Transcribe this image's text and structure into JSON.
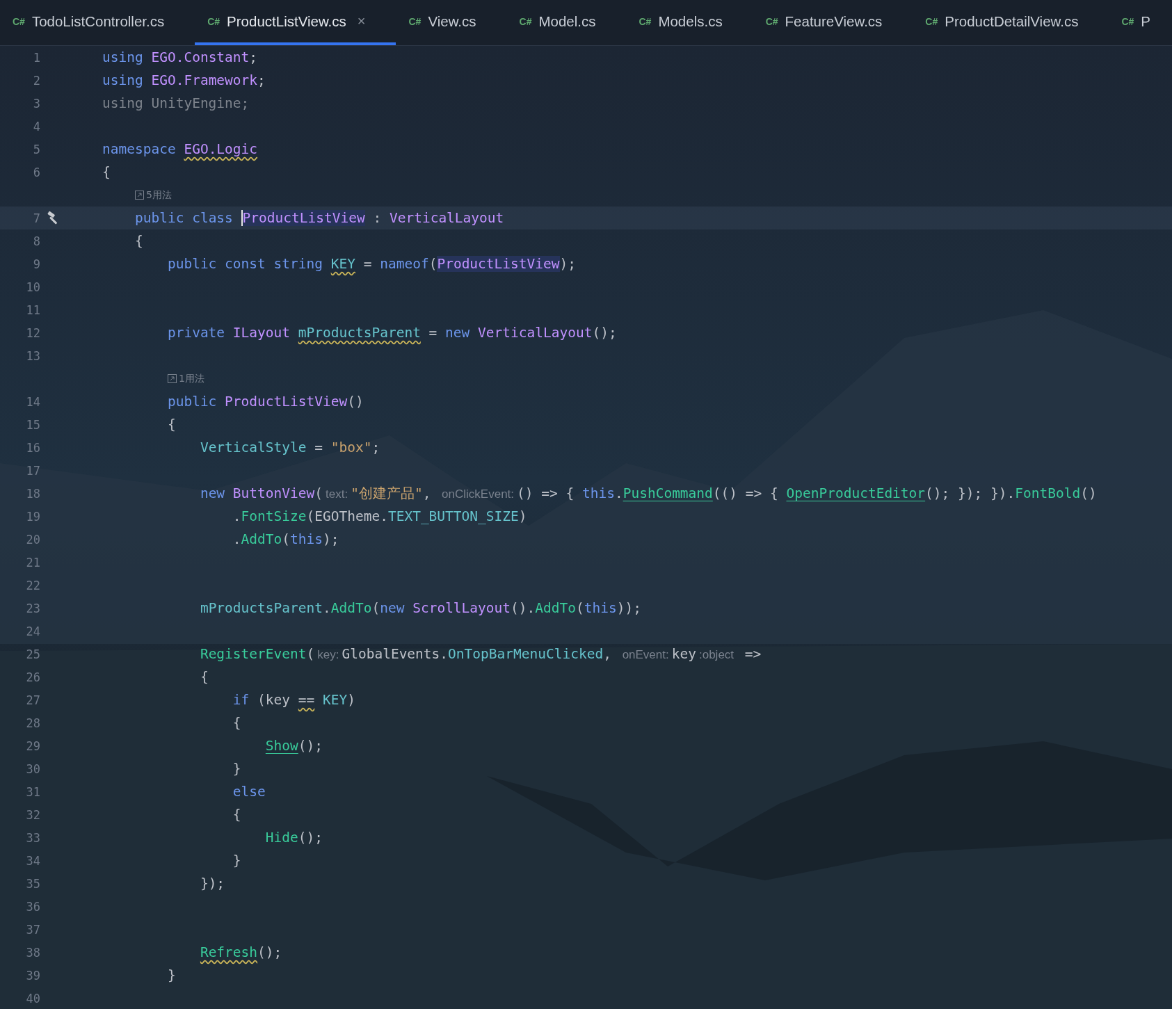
{
  "tabs": [
    {
      "icon": "C#",
      "label": "TodoListController.cs",
      "selected": false
    },
    {
      "icon": "C#",
      "label": "ProductListView.cs",
      "selected": true,
      "close": "×"
    },
    {
      "icon": "C#",
      "label": "View.cs",
      "selected": false
    },
    {
      "icon": "C#",
      "label": "Model.cs",
      "selected": false
    },
    {
      "icon": "C#",
      "label": "Models.cs",
      "selected": false
    },
    {
      "icon": "C#",
      "label": "FeatureView.cs",
      "selected": false
    },
    {
      "icon": "C#",
      "label": "ProductDetailView.cs",
      "selected": false
    },
    {
      "icon": "C#",
      "label": "P",
      "selected": false
    }
  ],
  "editor": {
    "rows": [
      {
        "kind": "code",
        "number": "1",
        "indent": "",
        "tokens": [
          {
            "kind": "kw",
            "text": "using "
          },
          {
            "kind": "type",
            "text": "EGO.Constant"
          },
          {
            "kind": "plain",
            "text": ";"
          }
        ]
      },
      {
        "kind": "code",
        "number": "2",
        "indent": "",
        "tokens": [
          {
            "kind": "kw",
            "text": "using "
          },
          {
            "kind": "type",
            "text": "EGO.Framework"
          },
          {
            "kind": "plain",
            "text": ";"
          }
        ]
      },
      {
        "kind": "code",
        "number": "3",
        "indent": "",
        "tokens": [
          {
            "kind": "dim",
            "text": "using UnityEngine;"
          }
        ]
      },
      {
        "kind": "code",
        "number": "4",
        "indent": ""
      },
      {
        "kind": "code",
        "number": "5",
        "indent": "",
        "tokens": [
          {
            "kind": "kw",
            "text": "namespace "
          },
          {
            "kind": "type",
            "text": "EGO.Logic",
            "squiggly": true
          }
        ]
      },
      {
        "kind": "code",
        "number": "6",
        "indent": "",
        "tokens": [
          {
            "kind": "plain",
            "text": "{"
          }
        ]
      },
      {
        "kind": "usages",
        "indent": "    ",
        "text": "5用法"
      },
      {
        "kind": "code",
        "number": "7",
        "indent": "    ",
        "current": true,
        "build_marker": true,
        "tokens": [
          {
            "kind": "kw",
            "text": "public class "
          },
          {
            "kind": "type",
            "text": "ProductListView",
            "highlighted": true,
            "caret": true
          },
          {
            "kind": "plain",
            "text": " : "
          },
          {
            "kind": "type",
            "text": "VerticalLayout"
          }
        ]
      },
      {
        "kind": "code",
        "number": "8",
        "indent": "    ",
        "tokens": [
          {
            "kind": "plain",
            "text": "{"
          }
        ]
      },
      {
        "kind": "code",
        "number": "9",
        "indent": "        ",
        "tokens": [
          {
            "kind": "kw",
            "text": "public const string "
          },
          {
            "kind": "field",
            "text": "KEY",
            "squiggly": true
          },
          {
            "kind": "plain",
            "text": " = "
          },
          {
            "kind": "kw",
            "text": "nameof"
          },
          {
            "kind": "plain",
            "text": "("
          },
          {
            "kind": "type",
            "text": "ProductListView",
            "highlighted": true
          },
          {
            "kind": "plain",
            "text": ");"
          }
        ]
      },
      {
        "kind": "code",
        "number": "10",
        "indent": ""
      },
      {
        "kind": "code",
        "number": "11",
        "indent": ""
      },
      {
        "kind": "code",
        "number": "12",
        "indent": "        ",
        "tokens": [
          {
            "kind": "kw",
            "text": "private "
          },
          {
            "kind": "type",
            "text": "ILayout "
          },
          {
            "kind": "field",
            "text": "mProductsParent",
            "squiggly": true
          },
          {
            "kind": "plain",
            "text": " = "
          },
          {
            "kind": "kw",
            "text": "new "
          },
          {
            "kind": "type",
            "text": "VerticalLayout"
          },
          {
            "kind": "plain",
            "text": "();"
          }
        ]
      },
      {
        "kind": "code",
        "number": "13",
        "indent": ""
      },
      {
        "kind": "usages",
        "indent": "        ",
        "text": "1用法"
      },
      {
        "kind": "code",
        "number": "14",
        "indent": "        ",
        "tokens": [
          {
            "kind": "kw",
            "text": "public "
          },
          {
            "kind": "type",
            "text": "ProductListView"
          },
          {
            "kind": "plain",
            "text": "()"
          }
        ]
      },
      {
        "kind": "code",
        "number": "15",
        "indent": "        ",
        "tokens": [
          {
            "kind": "plain",
            "text": "{"
          }
        ]
      },
      {
        "kind": "code",
        "number": "16",
        "indent": "            ",
        "tokens": [
          {
            "kind": "field",
            "text": "VerticalStyle"
          },
          {
            "kind": "plain",
            "text": " = "
          },
          {
            "kind": "str",
            "text": "\"box\""
          },
          {
            "kind": "plain",
            "text": ";"
          }
        ]
      },
      {
        "kind": "code",
        "number": "17",
        "indent": ""
      },
      {
        "kind": "code",
        "number": "18",
        "indent": "            ",
        "tokens": [
          {
            "kind": "kw",
            "text": "new "
          },
          {
            "kind": "type",
            "text": "ButtonView"
          },
          {
            "kind": "plain",
            "text": "("
          },
          {
            "kind": "hint",
            "text": "text:"
          },
          {
            "kind": "str",
            "text": "\"创建产品\""
          },
          {
            "kind": "plain",
            "text": ", "
          },
          {
            "kind": "hint",
            "text": "onClickEvent:"
          },
          {
            "kind": "plain",
            "text": "() => { "
          },
          {
            "kind": "kw",
            "text": "this"
          },
          {
            "kind": "plain",
            "text": "."
          },
          {
            "kind": "method",
            "text": "PushCommand",
            "linked": true
          },
          {
            "kind": "plain",
            "text": "(() => { "
          },
          {
            "kind": "method",
            "text": "OpenProductEditor",
            "linked": true
          },
          {
            "kind": "plain",
            "text": "(); }); })."
          },
          {
            "kind": "method",
            "text": "FontBold"
          },
          {
            "kind": "plain",
            "text": "()"
          }
        ]
      },
      {
        "kind": "code",
        "number": "19",
        "indent": "                ",
        "tokens": [
          {
            "kind": "plain",
            "text": "."
          },
          {
            "kind": "method",
            "text": "FontSize"
          },
          {
            "kind": "plain",
            "text": "(EGOTheme."
          },
          {
            "kind": "field",
            "text": "TEXT_BUTTON_SIZE"
          },
          {
            "kind": "plain",
            "text": ")"
          }
        ]
      },
      {
        "kind": "code",
        "number": "20",
        "indent": "                ",
        "tokens": [
          {
            "kind": "plain",
            "text": "."
          },
          {
            "kind": "method",
            "text": "AddTo"
          },
          {
            "kind": "plain",
            "text": "("
          },
          {
            "kind": "kw",
            "text": "this"
          },
          {
            "kind": "plain",
            "text": ");"
          }
        ]
      },
      {
        "kind": "code",
        "number": "21",
        "indent": ""
      },
      {
        "kind": "code",
        "number": "22",
        "indent": ""
      },
      {
        "kind": "code",
        "number": "23",
        "indent": "            ",
        "tokens": [
          {
            "kind": "field",
            "text": "mProductsParent"
          },
          {
            "kind": "plain",
            "text": "."
          },
          {
            "kind": "method",
            "text": "AddTo"
          },
          {
            "kind": "plain",
            "text": "("
          },
          {
            "kind": "kw",
            "text": "new "
          },
          {
            "kind": "type",
            "text": "ScrollLayout"
          },
          {
            "kind": "plain",
            "text": "()."
          },
          {
            "kind": "method",
            "text": "AddTo"
          },
          {
            "kind": "plain",
            "text": "("
          },
          {
            "kind": "kw",
            "text": "this"
          },
          {
            "kind": "plain",
            "text": "));"
          }
        ]
      },
      {
        "kind": "code",
        "number": "24",
        "indent": ""
      },
      {
        "kind": "code",
        "number": "25",
        "indent": "            ",
        "tokens": [
          {
            "kind": "method",
            "text": "RegisterEvent"
          },
          {
            "kind": "plain",
            "text": "("
          },
          {
            "kind": "hint",
            "text": "key:"
          },
          {
            "kind": "plain",
            "text": "GlobalEvents."
          },
          {
            "kind": "field",
            "text": "OnTopBarMenuClicked"
          },
          {
            "kind": "plain",
            "text": ", "
          },
          {
            "kind": "hint",
            "text": "onEvent:"
          },
          {
            "kind": "plain",
            "text": "key"
          },
          {
            "kind": "hint",
            "text": ":object"
          },
          {
            "kind": "plain",
            "text": " =>"
          }
        ]
      },
      {
        "kind": "code",
        "number": "26",
        "indent": "            ",
        "tokens": [
          {
            "kind": "plain",
            "text": "{"
          }
        ]
      },
      {
        "kind": "code",
        "number": "27",
        "indent": "                ",
        "tokens": [
          {
            "kind": "kw",
            "text": "if"
          },
          {
            "kind": "plain",
            "text": " (key "
          },
          {
            "kind": "plain",
            "text": "==",
            "squiggly": true
          },
          {
            "kind": "field",
            "text": " KEY"
          },
          {
            "kind": "plain",
            "text": ")"
          }
        ]
      },
      {
        "kind": "code",
        "number": "28",
        "indent": "                ",
        "tokens": [
          {
            "kind": "plain",
            "text": "{"
          }
        ]
      },
      {
        "kind": "code",
        "number": "29",
        "indent": "                    ",
        "tokens": [
          {
            "kind": "method",
            "text": "Show",
            "linked": true
          },
          {
            "kind": "plain",
            "text": "();"
          }
        ]
      },
      {
        "kind": "code",
        "number": "30",
        "indent": "                ",
        "tokens": [
          {
            "kind": "plain",
            "text": "}"
          }
        ]
      },
      {
        "kind": "code",
        "number": "31",
        "indent": "                ",
        "tokens": [
          {
            "kind": "kw",
            "text": "else"
          }
        ]
      },
      {
        "kind": "code",
        "number": "32",
        "indent": "                ",
        "tokens": [
          {
            "kind": "plain",
            "text": "{"
          }
        ]
      },
      {
        "kind": "code",
        "number": "33",
        "indent": "                    ",
        "tokens": [
          {
            "kind": "method",
            "text": "Hide"
          },
          {
            "kind": "plain",
            "text": "();"
          }
        ]
      },
      {
        "kind": "code",
        "number": "34",
        "indent": "                ",
        "tokens": [
          {
            "kind": "plain",
            "text": "}"
          }
        ]
      },
      {
        "kind": "code",
        "number": "35",
        "indent": "            ",
        "tokens": [
          {
            "kind": "plain",
            "text": "});"
          }
        ]
      },
      {
        "kind": "code",
        "number": "36",
        "indent": ""
      },
      {
        "kind": "code",
        "number": "37",
        "indent": ""
      },
      {
        "kind": "code",
        "number": "38",
        "indent": "            ",
        "tokens": [
          {
            "kind": "method",
            "text": "Refresh",
            "squiggly": true
          },
          {
            "kind": "plain",
            "text": "();"
          }
        ]
      },
      {
        "kind": "code",
        "number": "39",
        "indent": "        ",
        "tokens": [
          {
            "kind": "plain",
            "text": "}"
          }
        ]
      },
      {
        "kind": "code",
        "number": "40",
        "indent": ""
      }
    ]
  }
}
